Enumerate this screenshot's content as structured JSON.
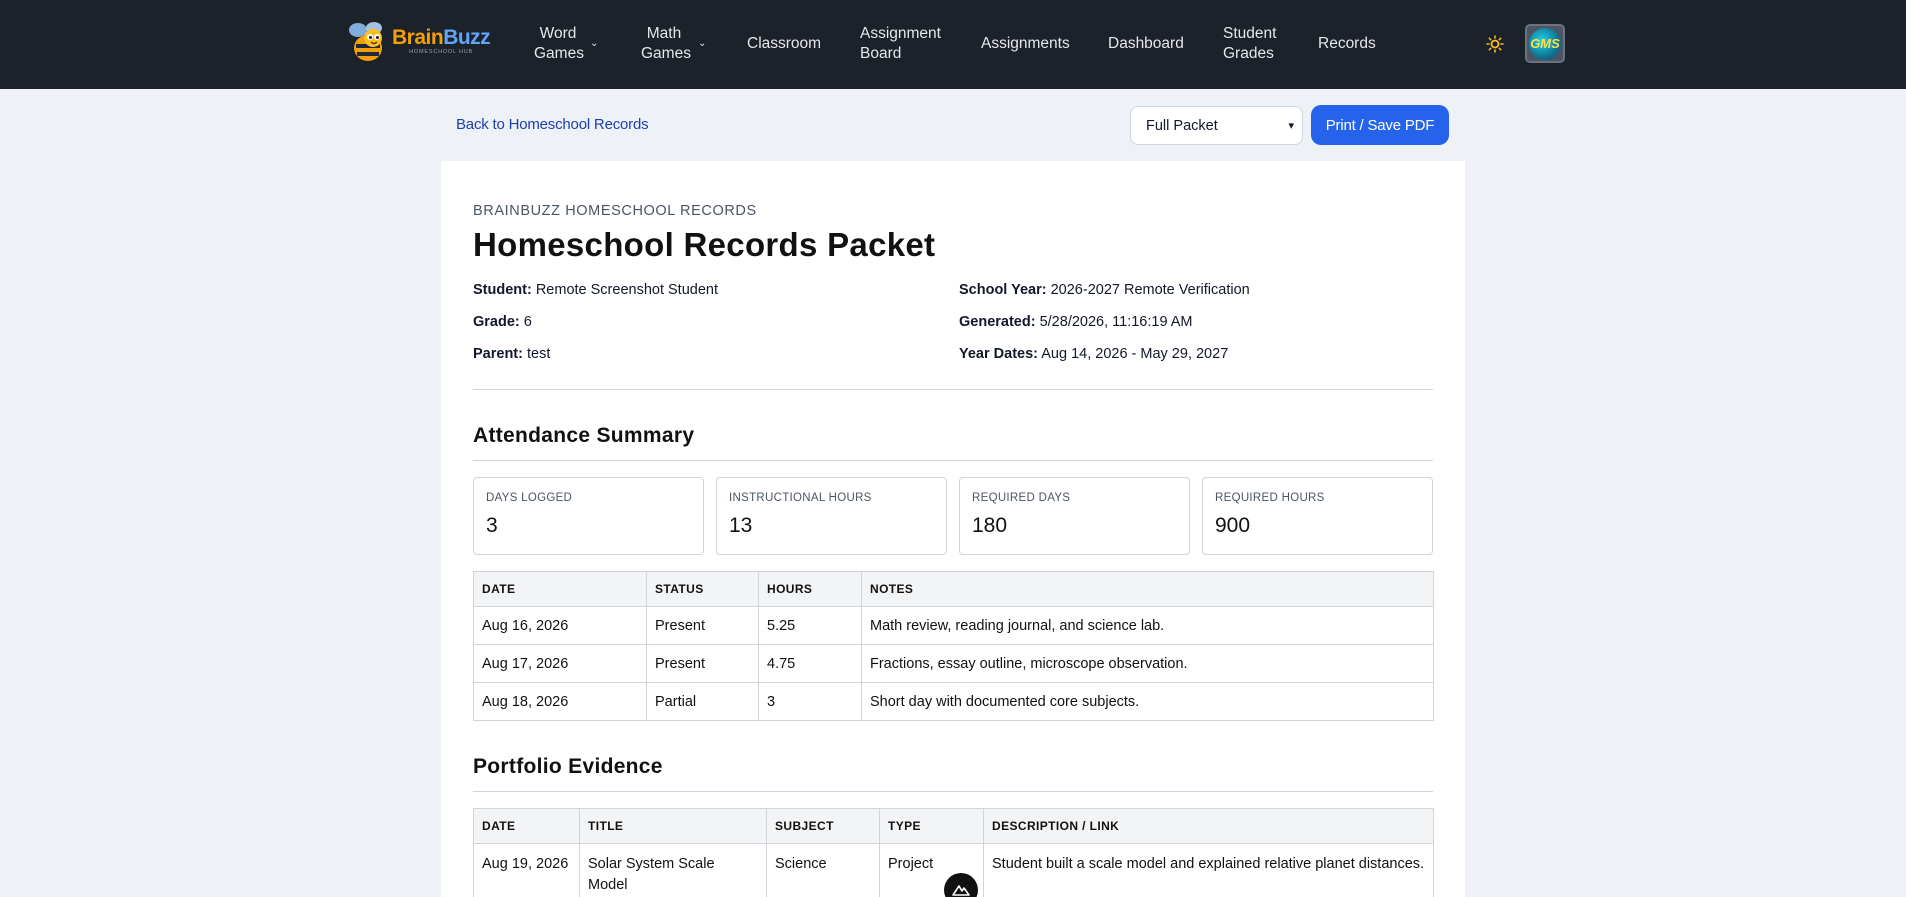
{
  "brand": {
    "name_part1": "Brain",
    "name_part2": "Buzz",
    "tagline": "HOMESCHOOL HUB"
  },
  "nav": {
    "word_games": "Word Games",
    "math_games": "Math Games",
    "classroom": "Classroom",
    "assignment_board": "Assignment Board",
    "assignments": "Assignments",
    "dashboard": "Dashboard",
    "student_grades": "Student Grades",
    "records": "Records"
  },
  "avatar_text": "GMS",
  "toolbar": {
    "back_label": "Back to Homeschool Records",
    "packet_select": "Full Packet",
    "print_label": "Print / Save PDF"
  },
  "header": {
    "eyebrow": "BRAINBUZZ HOMESCHOOL RECORDS",
    "title": "Homeschool Records Packet"
  },
  "meta": {
    "student_label": "Student:",
    "student": "Remote Screenshot Student",
    "grade_label": "Grade:",
    "grade": "6",
    "parent_label": "Parent:",
    "parent": "test",
    "school_year_label": "School Year:",
    "school_year": "2026-2027 Remote Verification",
    "generated_label": "Generated:",
    "generated": "5/28/2026, 11:16:19 AM",
    "year_dates_label": "Year Dates:",
    "year_dates": "Aug 14, 2026 - May 29, 2027"
  },
  "attendance": {
    "title": "Attendance Summary",
    "stats": [
      {
        "label": "DAYS LOGGED",
        "value": "3"
      },
      {
        "label": "INSTRUCTIONAL HOURS",
        "value": "13"
      },
      {
        "label": "REQUIRED DAYS",
        "value": "180"
      },
      {
        "label": "REQUIRED HOURS",
        "value": "900"
      }
    ],
    "columns": [
      "DATE",
      "STATUS",
      "HOURS",
      "NOTES"
    ],
    "rows": [
      [
        "Aug 16, 2026",
        "Present",
        "5.25",
        "Math review, reading journal, and science lab."
      ],
      [
        "Aug 17, 2026",
        "Present",
        "4.75",
        "Fractions, essay outline, microscope observation."
      ],
      [
        "Aug 18, 2026",
        "Partial",
        "3",
        "Short day with documented core subjects."
      ]
    ]
  },
  "portfolio": {
    "title": "Portfolio Evidence",
    "columns": [
      "DATE",
      "TITLE",
      "SUBJECT",
      "TYPE",
      "DESCRIPTION / LINK"
    ],
    "rows": [
      [
        "Aug 19, 2026",
        "Solar System Scale Model",
        "Science",
        "Project",
        "Student built a scale model and explained relative planet distances."
      ]
    ]
  }
}
